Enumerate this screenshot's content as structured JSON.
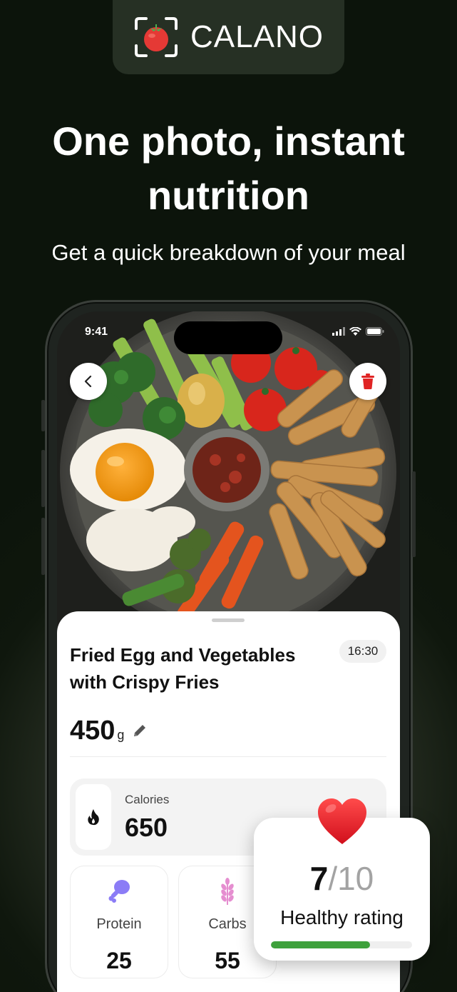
{
  "brand": {
    "name": "CALANO",
    "accent": "#e53935"
  },
  "hero": {
    "title_line1": "One photo, instant",
    "title_line2": "nutrition",
    "subtitle": "Get a quick breakdown of your meal"
  },
  "status_bar": {
    "time": "9:41"
  },
  "meal": {
    "title_line1": "Fried Egg and Vegetables",
    "title_line2": "with Crispy Fries",
    "time": "16:30",
    "weight": "450",
    "weight_unit": "g"
  },
  "calories": {
    "label": "Calories",
    "value": "650",
    "icon": "flame-icon"
  },
  "macros": [
    {
      "label": "Protein",
      "value": "25",
      "icon": "drumstick-icon",
      "color": "#8b7cf6"
    },
    {
      "label": "Carbs",
      "value": "55",
      "icon": "wheat-icon",
      "color": "#e58ed0"
    }
  ],
  "rating": {
    "score": "7",
    "max": "/10",
    "label": "Healthy rating",
    "fraction": 0.7,
    "bar_color": "#3ea13c",
    "icon": "heart-icon"
  },
  "buttons": {
    "back_icon": "chevron-left-icon",
    "delete_icon": "trash-icon",
    "delete_color": "#e02424"
  }
}
